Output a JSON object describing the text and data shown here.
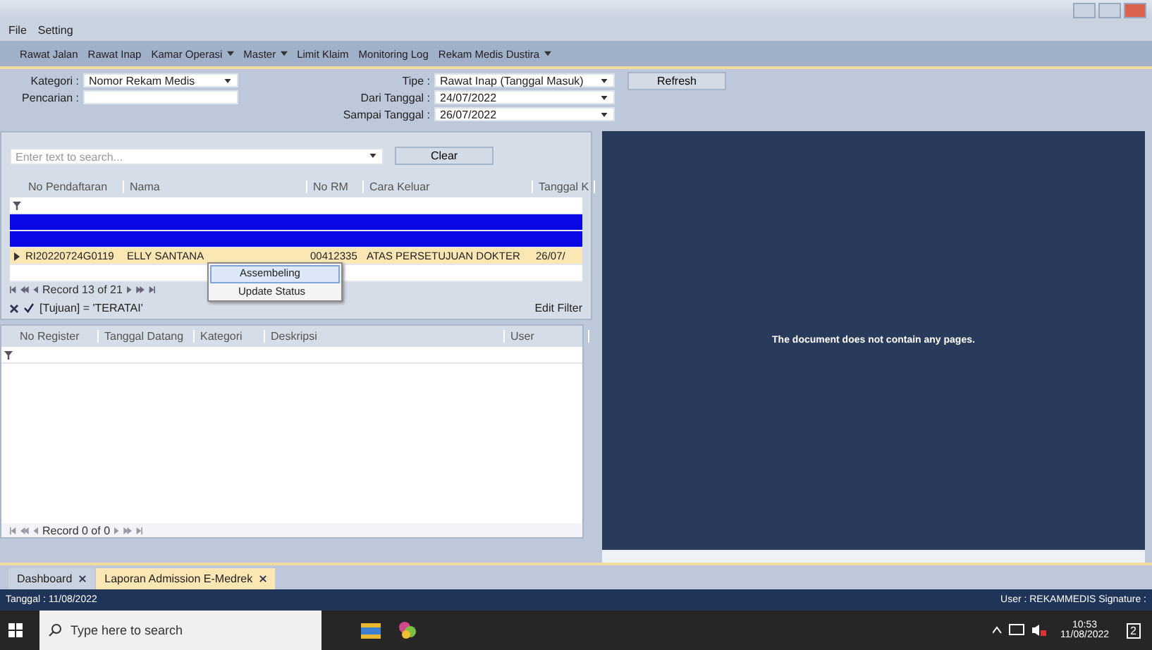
{
  "menu": [
    "File",
    "Setting"
  ],
  "toolbar": [
    {
      "label": "Rawat Jalan",
      "dropdown": false
    },
    {
      "label": "Rawat Inap",
      "dropdown": false
    },
    {
      "label": "Kamar Operasi",
      "dropdown": true
    },
    {
      "label": "Master",
      "dropdown": true
    },
    {
      "label": "Limit Klaim",
      "dropdown": false
    },
    {
      "label": "Monitoring Log",
      "dropdown": false
    },
    {
      "label": "Rekam Medis Dustira",
      "dropdown": true
    }
  ],
  "form": {
    "kategori_label": "Kategori :",
    "kategori": "Nomor Rekam Medis",
    "pencarian_label": "Pencarian :",
    "tipe_label": "Tipe :",
    "tipe": "Rawat Inap (Tanggal Masuk)",
    "dari_label": "Dari Tanggal :",
    "dari": "24/07/2022",
    "sampai_label": "Sampai Tanggal :",
    "sampai": "26/07/2022",
    "refresh": "Refresh"
  },
  "search": {
    "placeholder": "Enter text to search...",
    "clear": "Clear"
  },
  "grid": {
    "columns": [
      "No Pendaftaran",
      "Nama",
      "No RM",
      "Cara Keluar",
      "Tanggal K"
    ],
    "rows": [
      {
        "selected": true,
        "current": false
      },
      {
        "selected": true,
        "current": false
      },
      {
        "selected": false,
        "current": true,
        "cells": [
          "RI20220724G0119",
          "ELLY SANTANA",
          "00412335",
          "ATAS PERSETUJUAN DOKTER",
          "26/07/"
        ]
      },
      {
        "selected": false,
        "current": false
      }
    ],
    "navigator": "Record 13 of 21"
  },
  "context_menu": [
    {
      "label": "Assembeling",
      "selected": true
    },
    {
      "label": "Update Status",
      "selected": false
    }
  ],
  "filter": {
    "text": "[Tujuan] = 'TERATAI'",
    "checked": true,
    "edit": "Edit Filter"
  },
  "grid2": {
    "columns": [
      "No Register",
      "Tanggal Datang",
      "Kategori",
      "Deskripsi",
      "User"
    ],
    "navigator": "Record 0 of 0"
  },
  "preview": {
    "message": "The document does not contain any pages."
  },
  "tabs": [
    {
      "label": "Dashboard",
      "selected": false
    },
    {
      "label": "Laporan Admission E-Medrek",
      "selected": true
    }
  ],
  "status": {
    "left": "Tanggal : 11/08/2022",
    "right": "User : REKAMMEDIS Signature :"
  },
  "taskbar": {
    "search": "Type here to search",
    "time": "10:53",
    "date": "11/08/2022",
    "notifications": "2"
  }
}
